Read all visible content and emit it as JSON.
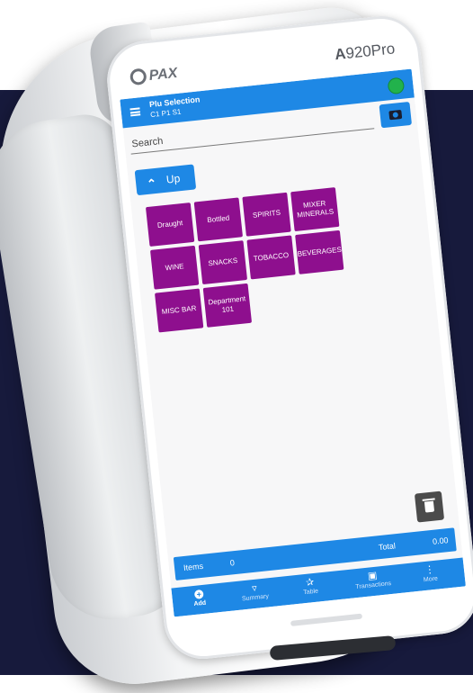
{
  "device": {
    "brand": "PAX",
    "model_bold": "A",
    "model_rest": "920Pro"
  },
  "appbar": {
    "title": "Plu Selection",
    "subtitle": "C1 P1 S1",
    "status_color": "#22b24c"
  },
  "search": {
    "placeholder": "Search"
  },
  "up_button": {
    "label": "Up"
  },
  "categories": [
    {
      "label": "Draught"
    },
    {
      "label": "Bottled"
    },
    {
      "label": "SPIRITS"
    },
    {
      "label": "MIXER MINERALS"
    },
    {
      "label": "WINE"
    },
    {
      "label": "SNACKS"
    },
    {
      "label": "TOBACCO"
    },
    {
      "label": "BEVERAGES"
    },
    {
      "label": "MISC BAR"
    },
    {
      "label": "Department 101"
    }
  ],
  "totals": {
    "items_label": "Items",
    "items_value": "0",
    "total_label": "Total",
    "total_value": "0.00"
  },
  "nav": [
    {
      "label": "Add",
      "icon": "add-icon"
    },
    {
      "label": "Summary",
      "icon": "basket-icon"
    },
    {
      "label": "Table",
      "icon": "cutlery-icon"
    },
    {
      "label": "Transactions",
      "icon": "book-icon"
    },
    {
      "label": "More",
      "icon": "more-vertical-icon"
    }
  ],
  "colors": {
    "primary": "#1e88e5",
    "category": "#8e0f8e",
    "background": "#171a3c"
  }
}
